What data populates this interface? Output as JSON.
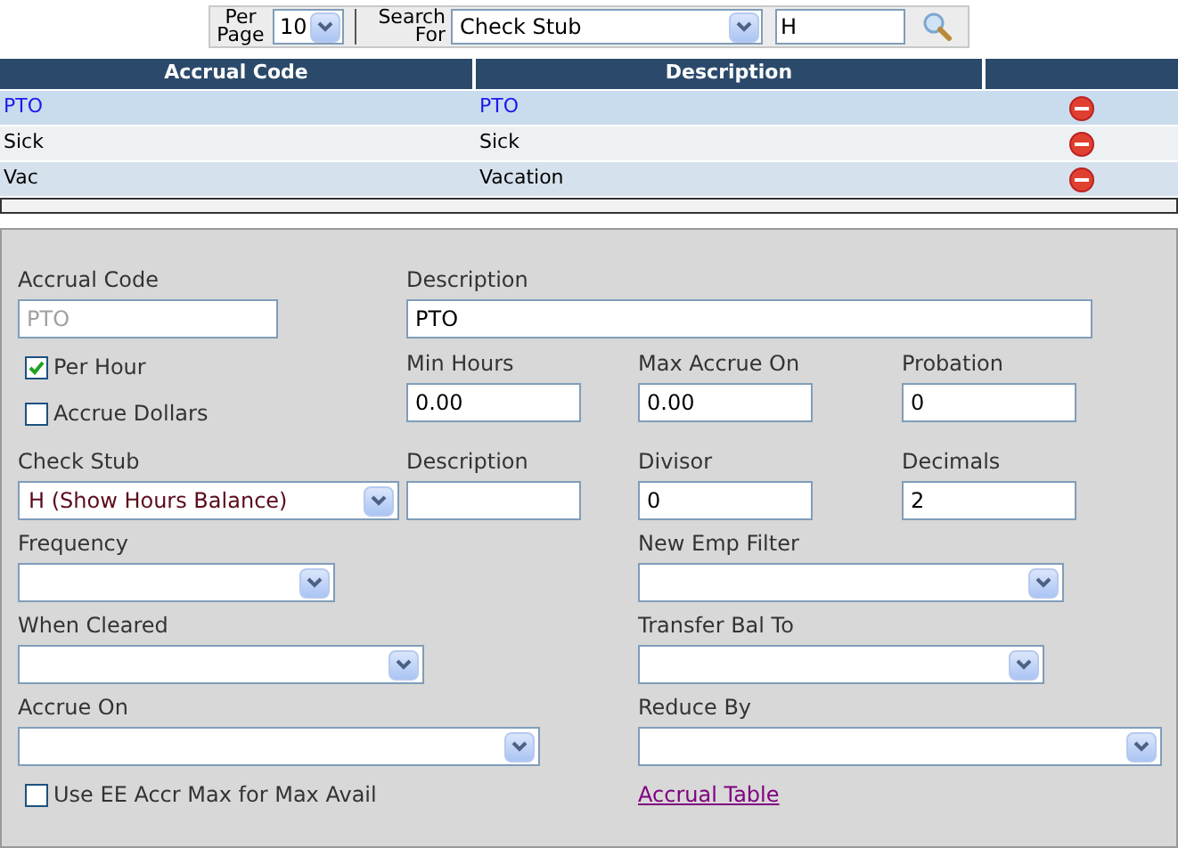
{
  "toolbar": {
    "per_page_label": "Per Page",
    "per_page_value": "10",
    "search_for_label": "Search For",
    "search_field": "Check Stub",
    "search_text": "H"
  },
  "table": {
    "columns": [
      {
        "label": "Accrual Code"
      },
      {
        "label": "Description"
      }
    ],
    "rows": [
      {
        "code": "PTO",
        "description": "PTO",
        "selected": true
      },
      {
        "code": "Sick",
        "description": "Sick",
        "selected": false
      },
      {
        "code": "Vac",
        "description": "Vacation",
        "selected": false
      }
    ]
  },
  "form": {
    "accrual_code": {
      "label": "Accrual Code",
      "value": "PTO",
      "disabled": true
    },
    "description": {
      "label": "Description",
      "value": "PTO"
    },
    "per_hour": {
      "label": "Per Hour",
      "checked": true
    },
    "accrue_dollars": {
      "label": "Accrue Dollars",
      "checked": false
    },
    "min_hours": {
      "label": "Min Hours",
      "value": "0.00"
    },
    "max_accrue_on": {
      "label": "Max Accrue On",
      "value": "0.00"
    },
    "probation": {
      "label": "Probation",
      "value": "0"
    },
    "check_stub": {
      "label": "Check Stub",
      "value": "H (Show Hours Balance)"
    },
    "stub_description": {
      "label": "Description"
    },
    "divisor": {
      "label": "Divisor",
      "value": "0"
    },
    "decimals": {
      "label": "Decimals",
      "value": "2"
    },
    "frequency": {
      "label": "Frequency"
    },
    "new_emp_filter": {
      "label": "New Emp Filter"
    },
    "when_cleared": {
      "label": "When Cleared"
    },
    "transfer_bal_to": {
      "label": "Transfer Bal To"
    },
    "accrue_on": {
      "label": "Accrue On"
    },
    "reduce_by": {
      "label": "Reduce By"
    },
    "use_ee_accr_max": {
      "label": "Use EE Accr Max for Max Avail",
      "checked": false
    },
    "accrual_table_link": {
      "label": "Accrual Table"
    }
  }
}
